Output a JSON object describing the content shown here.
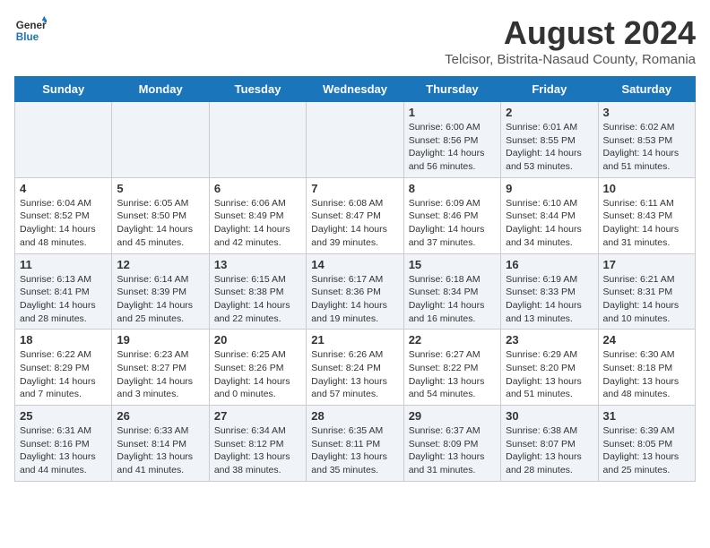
{
  "header": {
    "logo_line1": "General",
    "logo_line2": "Blue",
    "title": "August 2024",
    "subtitle": "Telcisor, Bistrita-Nasaud County, Romania"
  },
  "days": [
    "Sunday",
    "Monday",
    "Tuesday",
    "Wednesday",
    "Thursday",
    "Friday",
    "Saturday"
  ],
  "weeks": [
    [
      {
        "date": "",
        "text": ""
      },
      {
        "date": "",
        "text": ""
      },
      {
        "date": "",
        "text": ""
      },
      {
        "date": "",
        "text": ""
      },
      {
        "date": "1",
        "text": "Sunrise: 6:00 AM\nSunset: 8:56 PM\nDaylight: 14 hours\nand 56 minutes."
      },
      {
        "date": "2",
        "text": "Sunrise: 6:01 AM\nSunset: 8:55 PM\nDaylight: 14 hours\nand 53 minutes."
      },
      {
        "date": "3",
        "text": "Sunrise: 6:02 AM\nSunset: 8:53 PM\nDaylight: 14 hours\nand 51 minutes."
      }
    ],
    [
      {
        "date": "4",
        "text": "Sunrise: 6:04 AM\nSunset: 8:52 PM\nDaylight: 14 hours\nand 48 minutes."
      },
      {
        "date": "5",
        "text": "Sunrise: 6:05 AM\nSunset: 8:50 PM\nDaylight: 14 hours\nand 45 minutes."
      },
      {
        "date": "6",
        "text": "Sunrise: 6:06 AM\nSunset: 8:49 PM\nDaylight: 14 hours\nand 42 minutes."
      },
      {
        "date": "7",
        "text": "Sunrise: 6:08 AM\nSunset: 8:47 PM\nDaylight: 14 hours\nand 39 minutes."
      },
      {
        "date": "8",
        "text": "Sunrise: 6:09 AM\nSunset: 8:46 PM\nDaylight: 14 hours\nand 37 minutes."
      },
      {
        "date": "9",
        "text": "Sunrise: 6:10 AM\nSunset: 8:44 PM\nDaylight: 14 hours\nand 34 minutes."
      },
      {
        "date": "10",
        "text": "Sunrise: 6:11 AM\nSunset: 8:43 PM\nDaylight: 14 hours\nand 31 minutes."
      }
    ],
    [
      {
        "date": "11",
        "text": "Sunrise: 6:13 AM\nSunset: 8:41 PM\nDaylight: 14 hours\nand 28 minutes."
      },
      {
        "date": "12",
        "text": "Sunrise: 6:14 AM\nSunset: 8:39 PM\nDaylight: 14 hours\nand 25 minutes."
      },
      {
        "date": "13",
        "text": "Sunrise: 6:15 AM\nSunset: 8:38 PM\nDaylight: 14 hours\nand 22 minutes."
      },
      {
        "date": "14",
        "text": "Sunrise: 6:17 AM\nSunset: 8:36 PM\nDaylight: 14 hours\nand 19 minutes."
      },
      {
        "date": "15",
        "text": "Sunrise: 6:18 AM\nSunset: 8:34 PM\nDaylight: 14 hours\nand 16 minutes."
      },
      {
        "date": "16",
        "text": "Sunrise: 6:19 AM\nSunset: 8:33 PM\nDaylight: 14 hours\nand 13 minutes."
      },
      {
        "date": "17",
        "text": "Sunrise: 6:21 AM\nSunset: 8:31 PM\nDaylight: 14 hours\nand 10 minutes."
      }
    ],
    [
      {
        "date": "18",
        "text": "Sunrise: 6:22 AM\nSunset: 8:29 PM\nDaylight: 14 hours\nand 7 minutes."
      },
      {
        "date": "19",
        "text": "Sunrise: 6:23 AM\nSunset: 8:27 PM\nDaylight: 14 hours\nand 3 minutes."
      },
      {
        "date": "20",
        "text": "Sunrise: 6:25 AM\nSunset: 8:26 PM\nDaylight: 14 hours\nand 0 minutes."
      },
      {
        "date": "21",
        "text": "Sunrise: 6:26 AM\nSunset: 8:24 PM\nDaylight: 13 hours\nand 57 minutes."
      },
      {
        "date": "22",
        "text": "Sunrise: 6:27 AM\nSunset: 8:22 PM\nDaylight: 13 hours\nand 54 minutes."
      },
      {
        "date": "23",
        "text": "Sunrise: 6:29 AM\nSunset: 8:20 PM\nDaylight: 13 hours\nand 51 minutes."
      },
      {
        "date": "24",
        "text": "Sunrise: 6:30 AM\nSunset: 8:18 PM\nDaylight: 13 hours\nand 48 minutes."
      }
    ],
    [
      {
        "date": "25",
        "text": "Sunrise: 6:31 AM\nSunset: 8:16 PM\nDaylight: 13 hours\nand 44 minutes."
      },
      {
        "date": "26",
        "text": "Sunrise: 6:33 AM\nSunset: 8:14 PM\nDaylight: 13 hours\nand 41 minutes."
      },
      {
        "date": "27",
        "text": "Sunrise: 6:34 AM\nSunset: 8:12 PM\nDaylight: 13 hours\nand 38 minutes."
      },
      {
        "date": "28",
        "text": "Sunrise: 6:35 AM\nSunset: 8:11 PM\nDaylight: 13 hours\nand 35 minutes."
      },
      {
        "date": "29",
        "text": "Sunrise: 6:37 AM\nSunset: 8:09 PM\nDaylight: 13 hours\nand 31 minutes."
      },
      {
        "date": "30",
        "text": "Sunrise: 6:38 AM\nSunset: 8:07 PM\nDaylight: 13 hours\nand 28 minutes."
      },
      {
        "date": "31",
        "text": "Sunrise: 6:39 AM\nSunset: 8:05 PM\nDaylight: 13 hours\nand 25 minutes."
      }
    ]
  ]
}
